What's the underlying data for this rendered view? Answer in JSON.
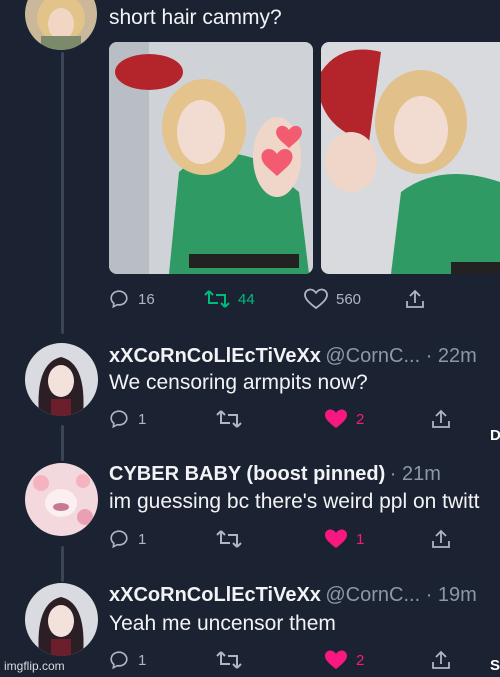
{
  "colors": {
    "background": "#1b2333",
    "retweet_active": "#00ba7c",
    "like_active": "#f91880",
    "muted": "#8b98a5"
  },
  "original_tweet": {
    "text": "short hair cammy?",
    "avatar_icon": "profile-avatar-blonde",
    "stats": {
      "replies": "16",
      "retweets": "44",
      "likes": "560"
    },
    "retweet_active": true,
    "photos": [
      "cosplay-photo-left",
      "cosplay-photo-right"
    ]
  },
  "replies": [
    {
      "display_name": "xXCoRnCoLlEcTiVeXx",
      "handle_time": "@CornC... · 22m",
      "text": "We censoring armpits now?",
      "avatar_icon": "anime-avatar-dark-hair",
      "stats": {
        "replies": "1",
        "retweets": "",
        "likes": "2"
      },
      "liked": true
    },
    {
      "display_name": "CYBER BABY (boost pinned)",
      "handle_time": "· 21m",
      "text": "im guessing bc there's weird ppl on twitt",
      "avatar_icon": "pastel-avatar",
      "stats": {
        "replies": "1",
        "retweets": "",
        "likes": "1"
      },
      "liked": true
    },
    {
      "display_name": "xXCoRnCoLlEcTiVeXx",
      "handle_time": "@CornC... · 19m",
      "text": "Yeah me uncensor them",
      "avatar_icon": "anime-avatar-dark-hair",
      "stats": {
        "replies": "1",
        "retweets": "",
        "likes": "2"
      },
      "liked": true
    }
  ],
  "watermark": "imgflip.com",
  "edge_letters": [
    "D",
    "S"
  ]
}
